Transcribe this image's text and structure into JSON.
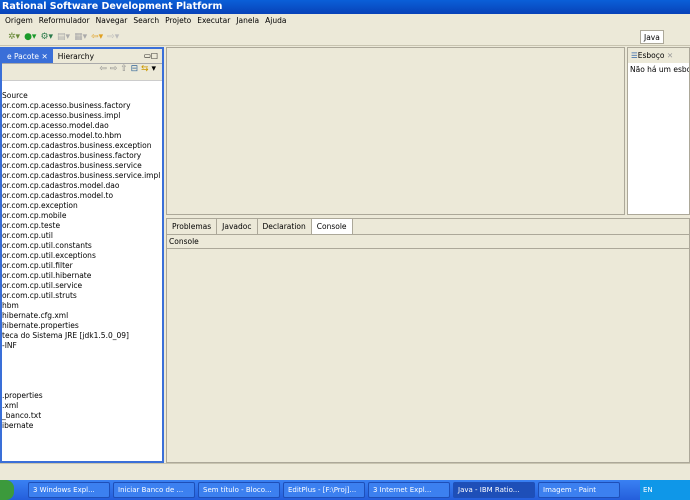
{
  "window": {
    "title": "Rational Software Development Platform"
  },
  "menu": [
    "Origem",
    "Reformulador",
    "Navegar",
    "Search",
    "Projeto",
    "Executar",
    "Janela",
    "Ajuda"
  ],
  "left_panel": {
    "tabs": [
      {
        "label": "e Pacote",
        "active": true
      },
      {
        "label": "Hierarchy",
        "active": false
      }
    ],
    "tree": [
      "Source",
      "or.com.cp.acesso.business.factory",
      "or.com.cp.acesso.business.impl",
      "or.com.cp.acesso.model.dao",
      "or.com.cp.acesso.model.to.hbm",
      "or.com.cp.cadastros.business.exception",
      "or.com.cp.cadastros.business.factory",
      "or.com.cp.cadastros.business.service",
      "or.com.cp.cadastros.business.service.impl",
      "or.com.cp.cadastros.model.dao",
      "or.com.cp.cadastros.model.to",
      "or.com.cp.exception",
      "or.com.cp.mobile",
      "or.com.cp.teste",
      "or.com.cp.util",
      "or.com.cp.util.constants",
      "or.com.cp.util.exceptions",
      "or.com.cp.util.filter",
      "or.com.cp.util.hibernate",
      "or.com.cp.util.service",
      "or.com.cp.util.struts",
      "hbm",
      "hibernate.cfg.xml",
      "hibernate.properties",
      "teca do Sistema JRE [jdk1.5.0_09]",
      "-INF",
      "",
      "",
      "",
      "",
      ".properties",
      ".xml",
      "_banco.txt",
      "ibernate"
    ]
  },
  "perspective": {
    "label": "Java"
  },
  "outline": {
    "tab": "Esboço",
    "message": "Não há um esboço disponível."
  },
  "console": {
    "tabs": [
      "Problemas",
      "Javadoc",
      "Declaration",
      "Console"
    ],
    "active": "Console",
    "header": "Console"
  },
  "taskbar": {
    "items": [
      "3 Windows Expl...",
      "Iniciar Banco de ...",
      "Sem título - Bloco...",
      "EditPlus - [F:\\Proj]...",
      "3 Internet Expl...",
      "Java - IBM Ratio...",
      "Imagem - Paint"
    ],
    "active": "Java - IBM Ratio...",
    "lang": "EN"
  }
}
